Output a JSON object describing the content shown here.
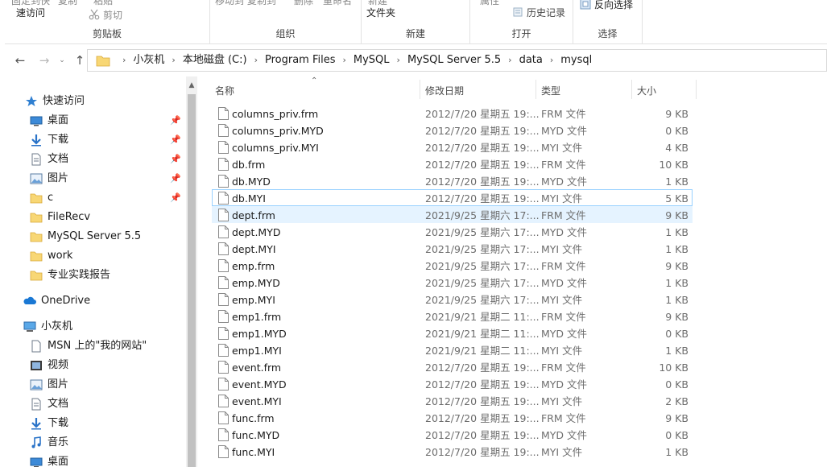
{
  "ribbon": {
    "clipboard": {
      "label": "剪贴板",
      "quick_access_text": "速访问",
      "cut": "剪切",
      "top_clip_1": "固定到快",
      "top_clip_2": "复制",
      "top_clip_3": "粘贴"
    },
    "organize": {
      "label": "组织",
      "top_clip": "移动到 复制到"
    },
    "organize_delete": "删除",
    "organize_rename": "重命名",
    "new": {
      "label": "新建",
      "folder": "文件夹",
      "top_clip": "新建"
    },
    "open": {
      "label": "打开",
      "properties": "属性",
      "history": "历史记录"
    },
    "select": {
      "label": "选择",
      "invert": "反向选择"
    }
  },
  "address": {
    "crumbs": [
      "小灰机",
      "本地磁盘 (C:)",
      "Program Files",
      "MySQL",
      "MySQL Server 5.5",
      "data",
      "mysql"
    ]
  },
  "nav": {
    "quick_access": "快速访问",
    "items": [
      {
        "label": "桌面",
        "icon": "desktop-icon",
        "pinned": true
      },
      {
        "label": "下载",
        "icon": "download-icon",
        "pinned": true
      },
      {
        "label": "文档",
        "icon": "document-icon",
        "pinned": true
      },
      {
        "label": "图片",
        "icon": "picture-icon",
        "pinned": true
      },
      {
        "label": "c",
        "icon": "folder-icon",
        "pinned": true
      },
      {
        "label": "FileRecv",
        "icon": "folder-icon",
        "pinned": false
      },
      {
        "label": "MySQL Server 5.5",
        "icon": "folder-icon",
        "pinned": false
      },
      {
        "label": "work",
        "icon": "folder-icon",
        "pinned": false
      },
      {
        "label": "专业实践报告",
        "icon": "folder-icon",
        "pinned": false
      }
    ],
    "onedrive": "OneDrive",
    "this_pc": "小灰机",
    "pc_items": [
      {
        "label": "MSN 上的\"我的网站\"",
        "icon": "web-document-icon"
      },
      {
        "label": "视频",
        "icon": "video-icon"
      },
      {
        "label": "图片",
        "icon": "picture-icon"
      },
      {
        "label": "文档",
        "icon": "document-icon"
      },
      {
        "label": "下载",
        "icon": "download-icon"
      },
      {
        "label": "音乐",
        "icon": "music-icon"
      },
      {
        "label": "桌面",
        "icon": "desktop-icon"
      }
    ]
  },
  "columns": {
    "name": "名称",
    "date": "修改日期",
    "type": "类型",
    "size": "大小"
  },
  "files": [
    {
      "name": "columns_priv.frm",
      "date": "2012/7/20 星期五 19:...",
      "type": "FRM 文件",
      "size": "9 KB"
    },
    {
      "name": "columns_priv.MYD",
      "date": "2012/7/20 星期五 19:...",
      "type": "MYD 文件",
      "size": "0 KB"
    },
    {
      "name": "columns_priv.MYI",
      "date": "2012/7/20 星期五 19:...",
      "type": "MYI 文件",
      "size": "4 KB"
    },
    {
      "name": "db.frm",
      "date": "2012/7/20 星期五 19:...",
      "type": "FRM 文件",
      "size": "10 KB"
    },
    {
      "name": "db.MYD",
      "date": "2012/7/20 星期五 19:...",
      "type": "MYD 文件",
      "size": "1 KB"
    },
    {
      "name": "db.MYI",
      "date": "2012/7/20 星期五 19:...",
      "type": "MYI 文件",
      "size": "5 KB"
    },
    {
      "name": "dept.frm",
      "date": "2021/9/25 星期六 17:...",
      "type": "FRM 文件",
      "size": "9 KB"
    },
    {
      "name": "dept.MYD",
      "date": "2021/9/25 星期六 17:...",
      "type": "MYD 文件",
      "size": "1 KB"
    },
    {
      "name": "dept.MYI",
      "date": "2021/9/25 星期六 17:...",
      "type": "MYI 文件",
      "size": "1 KB"
    },
    {
      "name": "emp.frm",
      "date": "2021/9/25 星期六 17:...",
      "type": "FRM 文件",
      "size": "9 KB"
    },
    {
      "name": "emp.MYD",
      "date": "2021/9/25 星期六 17:...",
      "type": "MYD 文件",
      "size": "1 KB"
    },
    {
      "name": "emp.MYI",
      "date": "2021/9/25 星期六 17:...",
      "type": "MYI 文件",
      "size": "1 KB"
    },
    {
      "name": "emp1.frm",
      "date": "2021/9/21 星期二 11:...",
      "type": "FRM 文件",
      "size": "9 KB"
    },
    {
      "name": "emp1.MYD",
      "date": "2021/9/21 星期二 11:...",
      "type": "MYD 文件",
      "size": "0 KB"
    },
    {
      "name": "emp1.MYI",
      "date": "2021/9/21 星期二 11:...",
      "type": "MYI 文件",
      "size": "1 KB"
    },
    {
      "name": "event.frm",
      "date": "2012/7/20 星期五 19:...",
      "type": "FRM 文件",
      "size": "10 KB"
    },
    {
      "name": "event.MYD",
      "date": "2012/7/20 星期五 19:...",
      "type": "MYD 文件",
      "size": "0 KB"
    },
    {
      "name": "event.MYI",
      "date": "2012/7/20 星期五 19:...",
      "type": "MYI 文件",
      "size": "2 KB"
    },
    {
      "name": "func.frm",
      "date": "2012/7/20 星期五 19:...",
      "type": "FRM 文件",
      "size": "9 KB"
    },
    {
      "name": "func.MYD",
      "date": "2012/7/20 星期五 19:...",
      "type": "MYD 文件",
      "size": "0 KB"
    },
    {
      "name": "func.MYI",
      "date": "2012/7/20 星期五 19:...",
      "type": "MYI 文件",
      "size": "1 KB"
    }
  ],
  "focused_row": 5,
  "hover_row": 6
}
